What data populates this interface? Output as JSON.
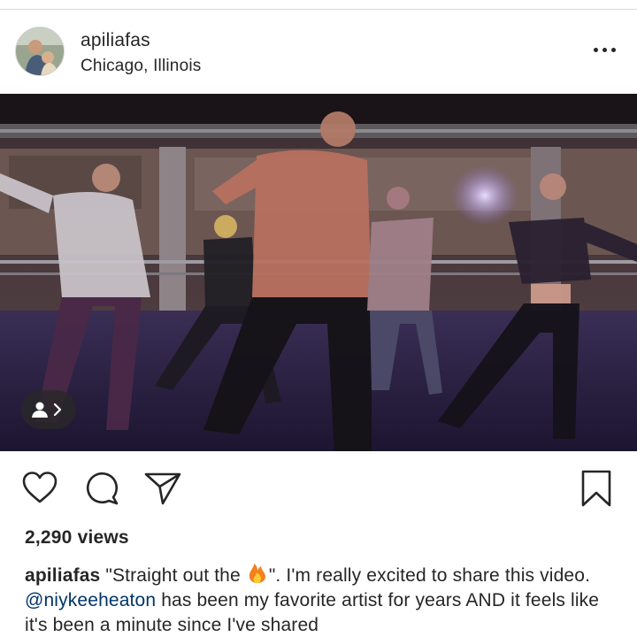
{
  "post": {
    "username": "apiliafas",
    "location": "Chicago, Illinois"
  },
  "icons": {
    "more": "more-options-icon",
    "user_tag": "user-tag-icon",
    "like": "heart-icon",
    "comment": "comment-icon",
    "share": "direct-share-icon",
    "save": "bookmark-icon",
    "emoji": "fire-emoji"
  },
  "stats": {
    "views": "2,290 views"
  },
  "caption": {
    "username": "apiliafas",
    "text_before_emoji": "\"Straight out the ",
    "text_after_emoji": "\". I'm really excited to share this video. ",
    "mention": "@niykeeheaton",
    "text_after_mention": " has been my favorite artist for years AND it feels like it's been a minute since I've shared"
  },
  "colors": {
    "text": "#262626",
    "mention": "#003569",
    "divider": "#dbdbdb"
  }
}
